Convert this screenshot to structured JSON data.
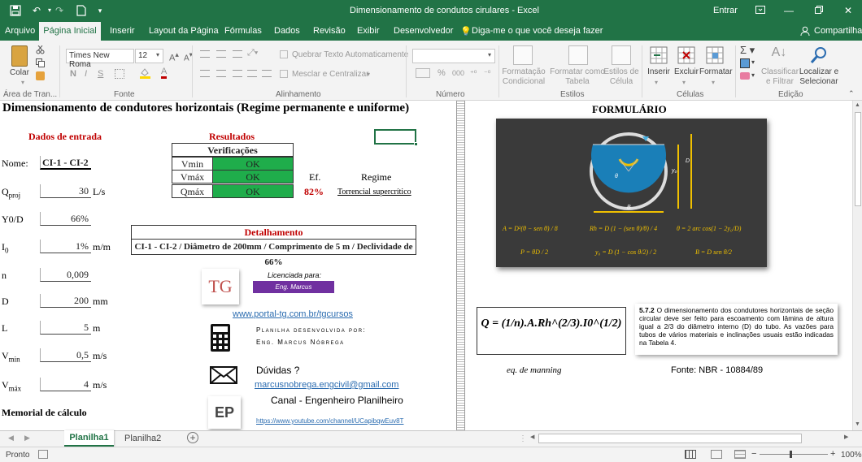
{
  "window": {
    "title": "Dimensionamento de condutos cirulares  -  Excel",
    "signin": "Entrar",
    "colors": {
      "excel_green": "#217346",
      "ok_green": "#1fad4b",
      "result_red": "#c00000",
      "badge_purple": "#7030a0"
    }
  },
  "tabs": [
    "Arquivo",
    "Página Inicial",
    "Inserir",
    "Layout da Página",
    "Fórmulas",
    "Dados",
    "Revisão",
    "Exibir",
    "Desenvolvedor"
  ],
  "tell_me": "Diga-me o que você deseja fazer",
  "share": "Compartilhar",
  "ribbon": {
    "paste": "Colar",
    "clipboard_label": "Área de Tran...",
    "font_name": "Times New Roma",
    "font_size": "12",
    "font_label": "Fonte",
    "wrap": "Quebrar Texto Automaticamente",
    "merge": "Mesclar e Centralizar",
    "alignment_label": "Alinhamento",
    "number_label": "Número",
    "cond_format": [
      "Formatação",
      "Condicional"
    ],
    "format_table": [
      "Formatar como",
      "Tabela"
    ],
    "cell_styles": [
      "Estilos de",
      "Célula"
    ],
    "styles_label": "Estilos",
    "insert": "Inserir",
    "delete": "Excluir",
    "format": "Formatar",
    "cells_label": "Células",
    "sort": [
      "Classificar",
      "e Filtrar"
    ],
    "find": [
      "Localizar e",
      "Selecionar"
    ],
    "edit_label": "Edição",
    "bold": "N",
    "italic": "I",
    "underline": "S",
    "percent": "%",
    "thousands": "000"
  },
  "sheet": {
    "main_title": "Dimensionamento de condutores horizontais (Regime permanente e uniforme)",
    "inputs_title": "Dados de entrada",
    "name_label": "Nome:",
    "name_value": "CI-1 - CI-2",
    "qproj_label": "Q",
    "qproj_sub": "proj",
    "qproj_value": "30",
    "qproj_unit": "L/s",
    "y0d_label": "Y0/D",
    "y0d_value": "66%",
    "i0_label": "I",
    "i0_sub": "0",
    "i0_value": "1%",
    "i0_unit": "m/m",
    "n_label": "n",
    "n_value": "0,009",
    "d_label": "D",
    "d_value": "200",
    "d_unit": "mm",
    "l_label": "L",
    "l_value": "5",
    "l_unit": "m",
    "vmin_label": "V",
    "vmin_sub": "min",
    "vmin_value": "0,5",
    "vmin_unit": "m/s",
    "vmax_label": "V",
    "vmax_sub": "máx",
    "vmax_value": "4",
    "vmax_unit": "m/s",
    "memorial": "Memorial de cálculo",
    "results_title": "Resultados",
    "verif_title": "Verificações",
    "verif": [
      {
        "label": "Vmin",
        "value": "OK"
      },
      {
        "label": "Vmáx",
        "value": "OK"
      },
      {
        "label": "Qmáx",
        "value": "OK"
      }
    ],
    "ef_label": "Ef.",
    "ef_value": "82%",
    "regime_label": "Regime",
    "regime_value": "Torrencial supercrítico",
    "detail_title": "Detalhamento",
    "detail_text": "CI-1 - CI-2 / Diâmetro de 200mm / Comprimento de 5 m / Declividade de 66%",
    "license_label": "Licenciada para:",
    "license_name": "Eng. Marcus",
    "tg_logo": "TG",
    "portal_link": "www.portal-tg.com.br/tgcursos",
    "dev_label": "Planilha desenvolvida por:",
    "dev_name": "Eng. Marcus Nóbrega",
    "doubts": "Dúvidas ?",
    "email": "marcusnobrega.engcivil@gmail.com",
    "channel": "Canal - Engenheiro Planilheiro",
    "ep_logo": "EP",
    "youtube": "https://www.youtube.com/channel/UCapibqwEuv8T",
    "formulario_title": "FORMULÁRIO",
    "fig_D": "D",
    "fig_y0": "y₀",
    "fig_theta": "θ",
    "fig_B": "B",
    "formula_A": "A = D²(θ − sen θ) / 8",
    "formula_Rh": "Rh = D (1 − (sen θ)/θ) / 4",
    "formula_theta": "θ = 2 arc cos(1 − 2y₀/D)",
    "formula_P": "P = θD / 2",
    "formula_y0": "y₀ = D (1 − cos θ/2) / 2",
    "formula_B": "B = D sen θ/2",
    "manning_formula": "Q = (1/n).A.Rh^(2/3).I0^(1/2)",
    "manning_caption": "eq. de manning",
    "nbr_ref": "5.7.2",
    "nbr_text": "O dimensionamento dos condutores horizontais de seção circular deve ser feito para escoamento com lâmina de altura igual a 2/3 do diâmetro interno (D) do tubo. As vazões para tubos de vários materiais e inclinações usuais estão indicadas na Tabela 4.",
    "nbr_source": "Fonte: NBR - 10884/89"
  },
  "sheet_tabs": [
    "Planilha1",
    "Planilha2"
  ],
  "status": {
    "ready": "Pronto",
    "zoom": "100%"
  }
}
